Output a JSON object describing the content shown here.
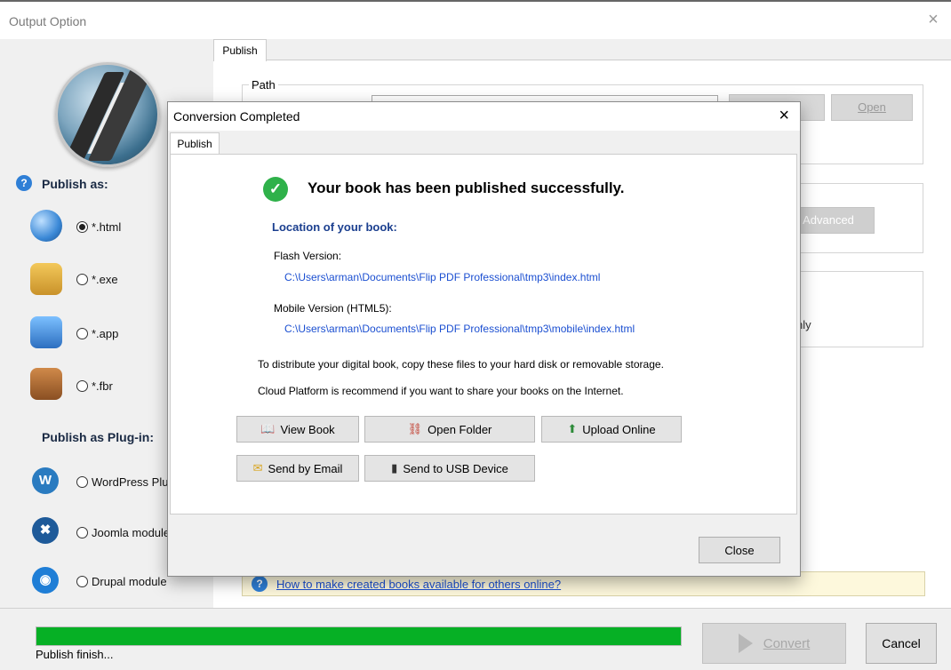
{
  "window": {
    "title": "Output Option",
    "close_glyph": "×"
  },
  "left": {
    "publish_as_label": "Publish as:",
    "formats": [
      {
        "label": "*.html",
        "selected": true,
        "icon": "globe-icon"
      },
      {
        "label": "*.exe",
        "selected": false,
        "icon": "lock-icon"
      },
      {
        "label": "*.app",
        "selected": false,
        "icon": "mac-finder-icon"
      },
      {
        "label": "*.fbr",
        "selected": false,
        "icon": "book-icon"
      }
    ],
    "plugin_label": "Publish as Plug-in:",
    "plugins": [
      {
        "label": "WordPress Plu",
        "icon": "wordpress-icon",
        "glyph": "W"
      },
      {
        "label": "Joomla module",
        "icon": "joomla-icon",
        "glyph": "✖"
      },
      {
        "label": "Drupal module",
        "icon": "drupal-icon",
        "glyph": "◉"
      }
    ]
  },
  "main": {
    "tab": "Publish",
    "path_legend": "Path",
    "open_label": "Open",
    "advanced_label": "Advanced",
    "partial_nly": "nly",
    "help_link": "How to make created books available for others online?"
  },
  "dialog": {
    "title": "Conversion Completed",
    "close_glyph": "×",
    "tab": "Publish",
    "headline": "Your book has been published successfully.",
    "location_label": "Location of your book:",
    "flash_label": "Flash Version:",
    "flash_path": "C:\\Users\\arman\\Documents\\Flip PDF Professional\\tmp3\\index.html",
    "mobile_label": "Mobile Version (HTML5):",
    "mobile_path": "C:\\Users\\arman\\Documents\\Flip PDF Professional\\tmp3\\mobile\\index.html",
    "distribute_text": "To distribute your digital book, copy these files to your hard disk or removable storage.",
    "cloud_text": "Cloud Platform is recommend if you want to share your books on the Internet.",
    "buttons": {
      "view_book": "View Book",
      "open_folder": "Open Folder",
      "upload_online": "Upload Online",
      "send_email": "Send by Email",
      "send_usb": "Send to USB Device",
      "close": "Close"
    }
  },
  "bottom": {
    "progress": 1.0,
    "status": "Publish finish...",
    "convert_label": "Convert",
    "cancel_label": "Cancel",
    "progress_color": "#06b025"
  }
}
